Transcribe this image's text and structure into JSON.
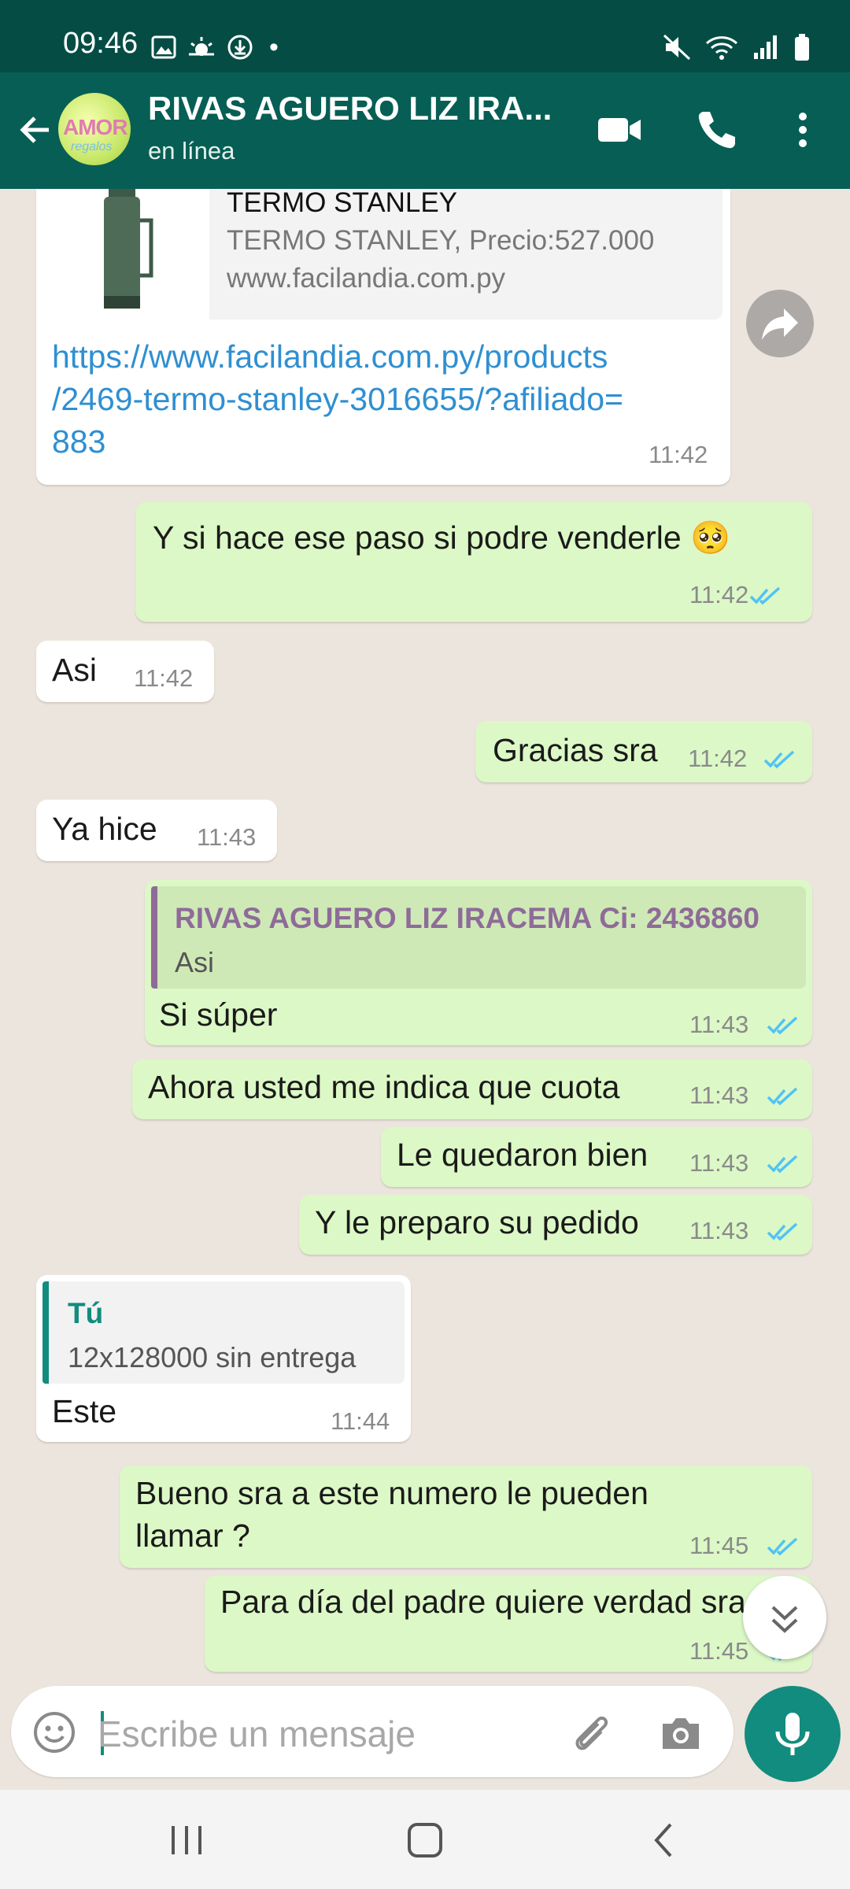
{
  "status_bar": {
    "time": "09:46",
    "dot": "•"
  },
  "header": {
    "avatar_text": "AMOR",
    "avatar_subtext": "regalos",
    "contact_name": "RIVAS AGUERO LIZ IRA...",
    "status": "en línea"
  },
  "link_preview": {
    "title": "TERMO STANLEY",
    "description": "TERMO STANLEY, Precio:527.000",
    "domain": "www.facilandia.com.py",
    "url_line1": "https://www.facilandia.com.py/products",
    "url_line2": "/2469-termo-stanley-3016655/?afiliado=",
    "url_line3": "883",
    "time": "11:42"
  },
  "messages": [
    {
      "dir": "out",
      "text": "Y si hace ese paso si podre venderle 🥺",
      "time": "11:42"
    },
    {
      "dir": "in",
      "text": "Asi",
      "time": "11:42"
    },
    {
      "dir": "out",
      "text": "Gracias sra",
      "time": "11:42"
    },
    {
      "dir": "in",
      "text": "Ya hice",
      "time": "11:43"
    },
    {
      "dir": "out",
      "text": "Si súper",
      "time": "11:43",
      "quote_author": "RIVAS AGUERO LIZ IRACEMA  Ci: 2436860",
      "quote_text": "Asi"
    },
    {
      "dir": "out",
      "text": "Ahora usted me indica que cuota",
      "time": "11:43"
    },
    {
      "dir": "out",
      "text": "Le quedaron bien",
      "time": "11:43"
    },
    {
      "dir": "out",
      "text": "Y le preparo su pedido",
      "time": "11:43"
    },
    {
      "dir": "in",
      "text": "Este",
      "time": "11:44",
      "quote_author": "Tú",
      "quote_text": "12x128000 sin entrega"
    },
    {
      "dir": "out",
      "text_line1": "Bueno sra a este numero le pueden",
      "text_line2": "llamar ?",
      "time": "11:45"
    },
    {
      "dir": "out",
      "text": "Para día del padre quiere verdad sra",
      "time": "11:45"
    }
  ],
  "input": {
    "placeholder": "Escribe un mensaje"
  },
  "colors": {
    "header": "#075e54",
    "status_bar": "#054d44",
    "outgoing_bubble": "#dcf8c6",
    "incoming_bubble": "#ffffff",
    "read_ticks": "#4fc3f7",
    "accent": "#128c7e",
    "quote_author_in": "#8e6b99",
    "quote_author_you": "#128c7e"
  },
  "icons": [
    "back-arrow-icon",
    "video-call-icon",
    "voice-call-icon",
    "more-options-icon",
    "forward-icon",
    "scroll-down-icon",
    "emoji-icon",
    "attach-icon",
    "camera-icon",
    "mic-icon",
    "recents-icon",
    "home-icon",
    "nav-back-icon"
  ]
}
